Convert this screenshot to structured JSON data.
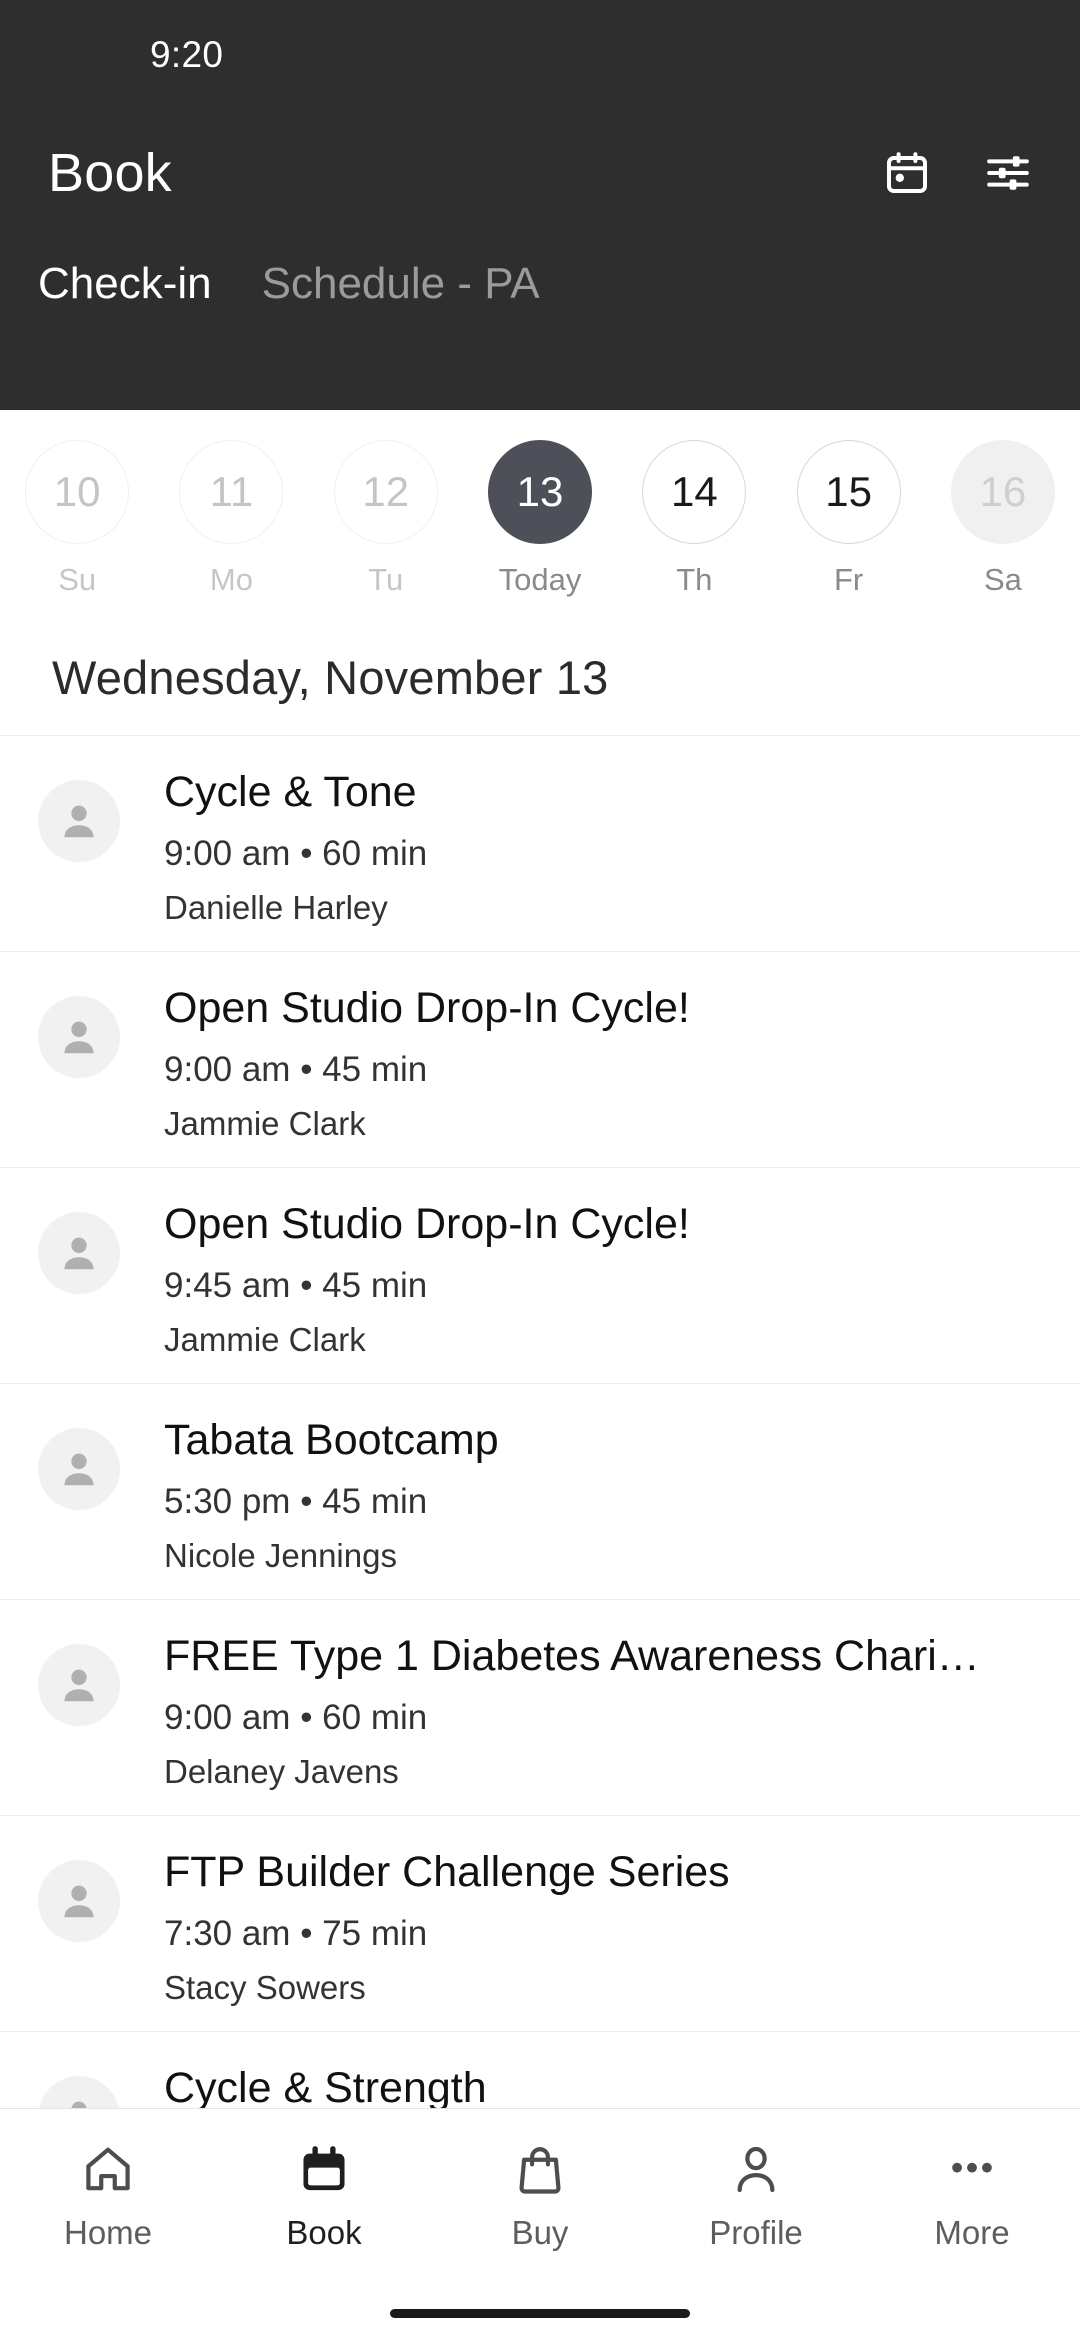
{
  "status_bar": {
    "time": "9:20"
  },
  "app_bar": {
    "title": "Book",
    "actions": [
      {
        "name": "calendar-icon",
        "label": "Calendar"
      },
      {
        "name": "filter-icon",
        "label": "Filters"
      }
    ]
  },
  "tabs": [
    {
      "label": "Check-in",
      "active": true
    },
    {
      "label": "Schedule - PA",
      "active": false
    }
  ],
  "date_strip": [
    {
      "day": "10",
      "weekday": "Su",
      "state": "past"
    },
    {
      "day": "11",
      "weekday": "Mo",
      "state": "past"
    },
    {
      "day": "12",
      "weekday": "Tu",
      "state": "past"
    },
    {
      "day": "13",
      "weekday": "Today",
      "state": "today"
    },
    {
      "day": "14",
      "weekday": "Th",
      "state": "future"
    },
    {
      "day": "15",
      "weekday": "Fr",
      "state": "future"
    },
    {
      "day": "16",
      "weekday": "Sa",
      "state": "dim"
    }
  ],
  "date_heading": "Wednesday, November 13",
  "classes": [
    {
      "title": "Cycle & Tone",
      "meta": "9:00 am • 60 min",
      "instructor": "Danielle Harley"
    },
    {
      "title": "Open Studio Drop-In Cycle!",
      "meta": "9:00 am • 45 min",
      "instructor": "Jammie Clark"
    },
    {
      "title": "Open Studio Drop-In Cycle!",
      "meta": "9:45 am • 45 min",
      "instructor": "Jammie Clark"
    },
    {
      "title": "Tabata Bootcamp",
      "meta": "5:30 pm • 45 min",
      "instructor": "Nicole Jennings"
    },
    {
      "title": "FREE Type 1 Diabetes Awareness Chari…",
      "meta": "9:00 am • 60 min",
      "instructor": "Delaney Javens"
    },
    {
      "title": "FTP Builder Challenge Series",
      "meta": "7:30 am • 75 min",
      "instructor": "Stacy Sowers"
    },
    {
      "title": "Cycle & Strength",
      "meta": "",
      "instructor": ""
    }
  ],
  "bottom_nav": [
    {
      "label": "Home",
      "icon": "home-icon",
      "active": false
    },
    {
      "label": "Book",
      "icon": "calendar-icon",
      "active": true
    },
    {
      "label": "Buy",
      "icon": "shopping-bag-icon",
      "active": false
    },
    {
      "label": "Profile",
      "icon": "person-icon",
      "active": false
    },
    {
      "label": "More",
      "icon": "ellipsis-icon",
      "active": false
    }
  ],
  "colors": {
    "header_bg": "#2e2e2e",
    "today_circle": "#4d5058",
    "divider": "#ededed",
    "muted_text": "#8a8a8a"
  }
}
